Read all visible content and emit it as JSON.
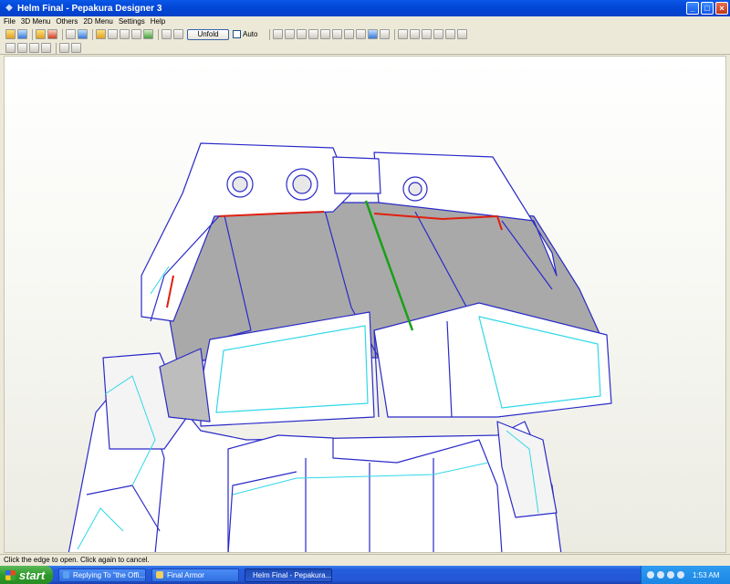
{
  "window": {
    "title": "Helm Final - Pepakura Designer 3",
    "minimize_label": "_",
    "maximize_label": "□",
    "close_label": "×"
  },
  "menu": [
    "File",
    "3D Menu",
    "Others",
    "2D Menu",
    "Settings",
    "Help"
  ],
  "toolbar": {
    "unfold_label": "Unfold",
    "auto_label": "Auto",
    "auto_checked": false
  },
  "status": {
    "text": "Click the edge to open. Click again to cancel."
  },
  "taskbar": {
    "start_label": "start",
    "tasks": [
      {
        "label": "Replying To \"the Offi...",
        "icon": "browser-icon"
      },
      {
        "label": "Final Armor",
        "icon": "folder-icon"
      },
      {
        "label": "Helm Final - Pepakura...",
        "icon": "pepakura-icon"
      }
    ],
    "clock": "1:53 AM"
  },
  "colors": {
    "model_edge": "#2a2ac8",
    "model_fold": "#30d8e8",
    "open_edge": "#e02010",
    "selected_edge": "#18a018",
    "face_white": "#ffffff",
    "face_gray": "#a9a9a9"
  }
}
